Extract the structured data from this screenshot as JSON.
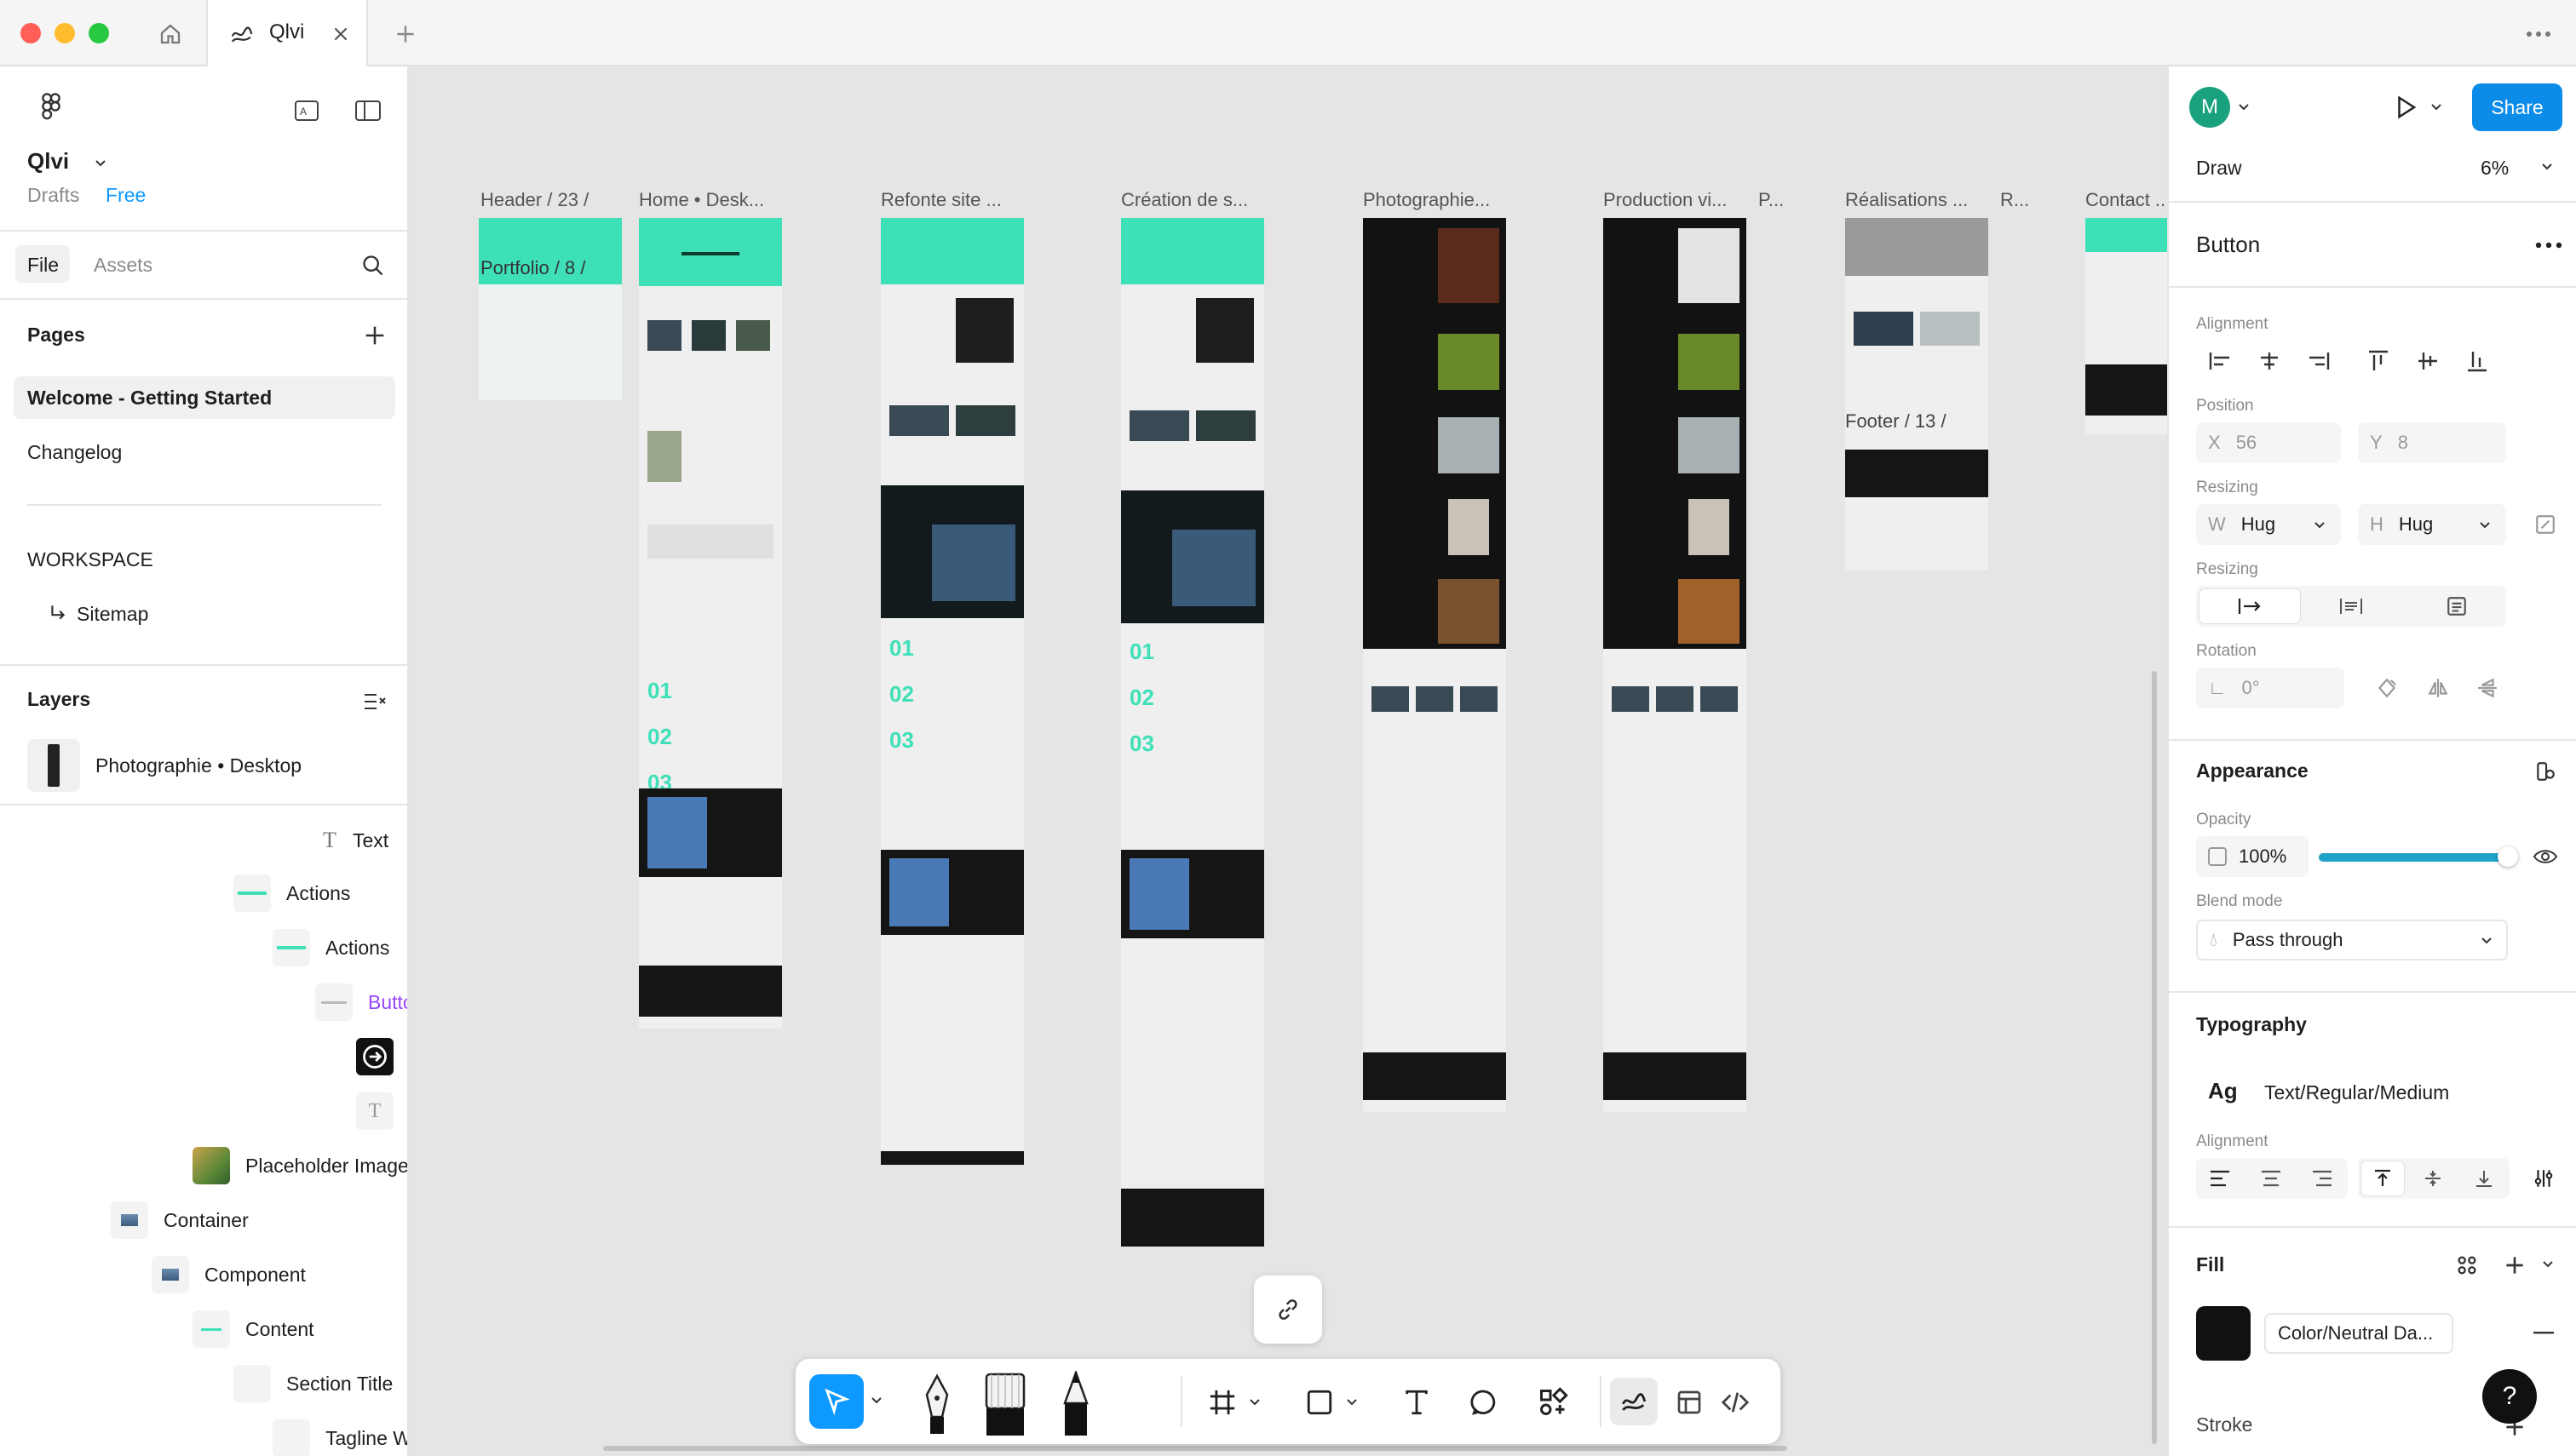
{
  "window": {
    "tab_title": "Qlvi"
  },
  "file": {
    "name": "Qlvi",
    "location": "Drafts",
    "plan": "Free"
  },
  "left_panel": {
    "tabs": {
      "file": "File",
      "assets": "Assets"
    },
    "pages_heading": "Pages",
    "pages": [
      "Welcome - Getting Started",
      "Changelog"
    ],
    "workspace_heading": "WORKSPACE",
    "workspace_items": [
      "Sitemap"
    ],
    "layers_heading": "Layers",
    "layers_root": "Photographie • Desktop",
    "layers": [
      "Text",
      "Actions",
      "Actions",
      "Butto",
      "",
      "",
      "Placeholder Image",
      "Container",
      "Component",
      "Content",
      "Section Title",
      "Tagline W"
    ]
  },
  "canvas": {
    "frame_labels": [
      "Header / 23 /",
      "Home • Desk...",
      "Refonte site ...",
      "Création de s...",
      "Photographie...",
      "Production vi...",
      "P...",
      "Réalisations ...",
      "R...",
      "Contact ..."
    ],
    "inner_labels": [
      "Portfolio / 8 /",
      "Footer / 13 /"
    ],
    "numbers": [
      "01",
      "02",
      "03"
    ]
  },
  "right_panel": {
    "user_initial": "M",
    "share_label": "Share",
    "mode": "Draw",
    "zoom": "6%",
    "selection": "Button",
    "alignment_label": "Alignment",
    "position_label": "Position",
    "x_label": "X",
    "x_value": "56",
    "y_label": "Y",
    "y_value": "8",
    "resizing_label": "Resizing",
    "w_label": "W",
    "w_value": "Hug",
    "h_label": "H",
    "h_value": "Hug",
    "resizing2_label": "Resizing",
    "rotation_label": "Rotation",
    "rotation_value": "0°",
    "appearance_label": "Appearance",
    "opacity_label": "Opacity",
    "opacity_value": "100%",
    "opacity_fraction": 1.0,
    "blend_label": "Blend mode",
    "blend_value": "Pass through",
    "typography_label": "Typography",
    "typo_sample": "Ag",
    "typo_style": "Text/Regular/Medium",
    "typo_alignment_label": "Alignment",
    "fill_label": "Fill",
    "fill_name": "Color/Neutral Da...",
    "fill_color": "#111111",
    "stroke_label": "Stroke",
    "help": "?"
  },
  "colors": {
    "accent": "#0d99ff",
    "share": "#0c8ce9",
    "teal": "#3ee0b8",
    "layer_purple": "#9747ff"
  }
}
